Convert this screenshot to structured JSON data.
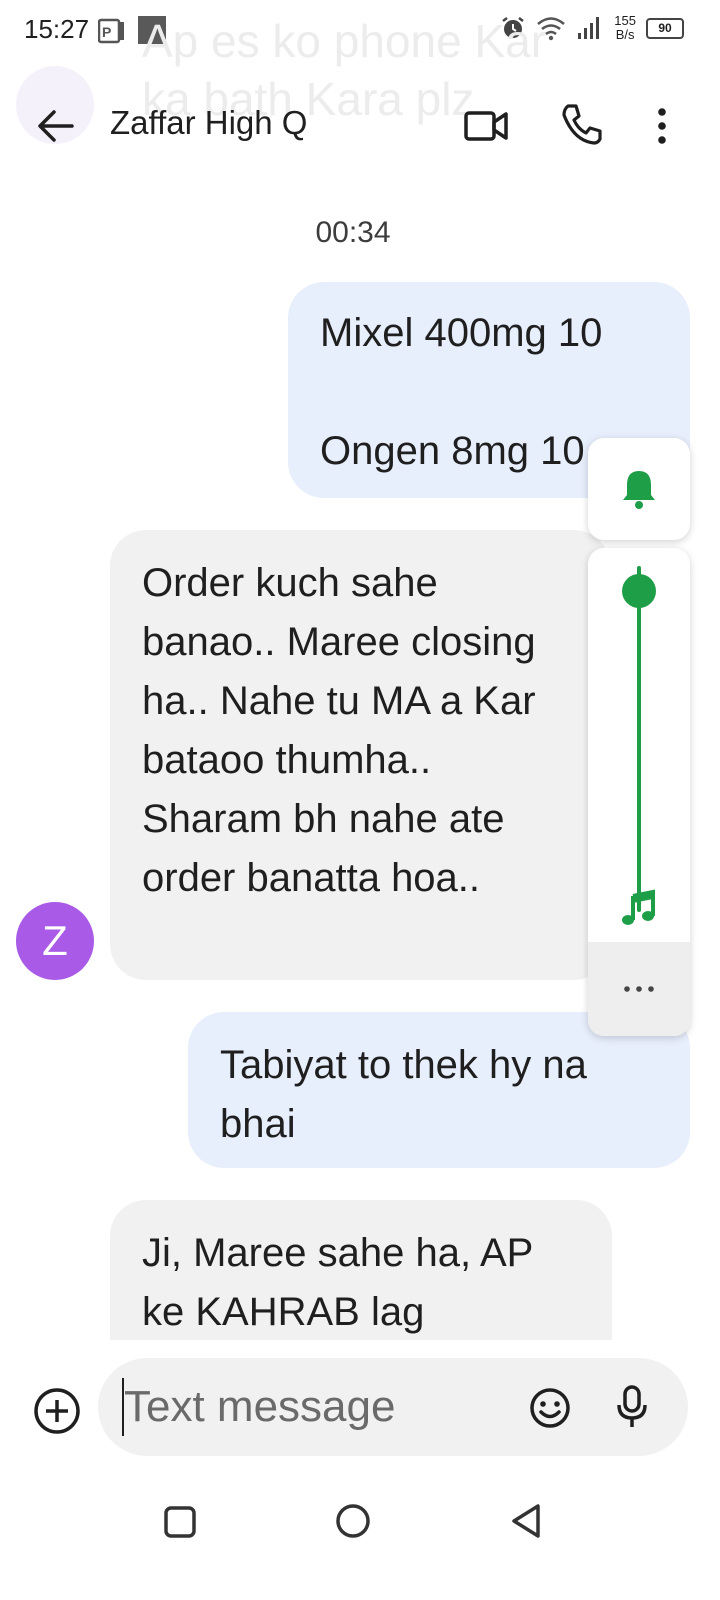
{
  "status_bar": {
    "time": "15:27",
    "net_speed_value": "155",
    "net_speed_unit": "B/s",
    "battery": "90",
    "icons": [
      "notification-icon",
      "image-icon",
      "alarm-icon",
      "wifi-icon",
      "signal-icon",
      "battery-icon"
    ]
  },
  "ghost_notification": {
    "text": "Ap es ko phone Kar\nka bath Kara plz"
  },
  "header": {
    "contact_name": "Zaffar High Q",
    "icons": [
      "back-arrow-icon",
      "video-call-icon",
      "phone-icon",
      "more-vert-icon"
    ]
  },
  "conversation": {
    "timestamp": "00:34",
    "messages": [
      {
        "direction": "outgoing",
        "lines": [
          "Mixel 400mg 10",
          "",
          "Ongen 8mg 10"
        ]
      },
      {
        "direction": "incoming",
        "sender_initial": "Z",
        "text": "Order kuch sahe banao.. Maree closing ha.. Nahe tu MA a Kar bataoo thumha.. Sharam bh nahe ate order banatta hoa.."
      },
      {
        "direction": "outgoing",
        "text": "Tabiyat to thek hy na bhai"
      },
      {
        "direction": "incoming",
        "text": "Ji, Maree sahe ha, AP ke KAHRAB lag"
      }
    ]
  },
  "volume_overlay": {
    "level_fraction": 1.0,
    "icons": [
      "bell-icon",
      "music-note-icon",
      "more-horiz-icon"
    ],
    "accent_color": "#1f9e48"
  },
  "compose": {
    "placeholder": "Text message",
    "value": "",
    "icons": [
      "add-circle-icon",
      "emoji-icon",
      "mic-icon"
    ]
  },
  "nav_bar": {
    "icons": [
      "recent-apps-icon",
      "home-icon",
      "back-triangle-icon"
    ]
  },
  "colors": {
    "outgoing_bubble": "#e7eefc",
    "incoming_bubble": "#f1f1f1",
    "avatar": "#a95ae6"
  }
}
